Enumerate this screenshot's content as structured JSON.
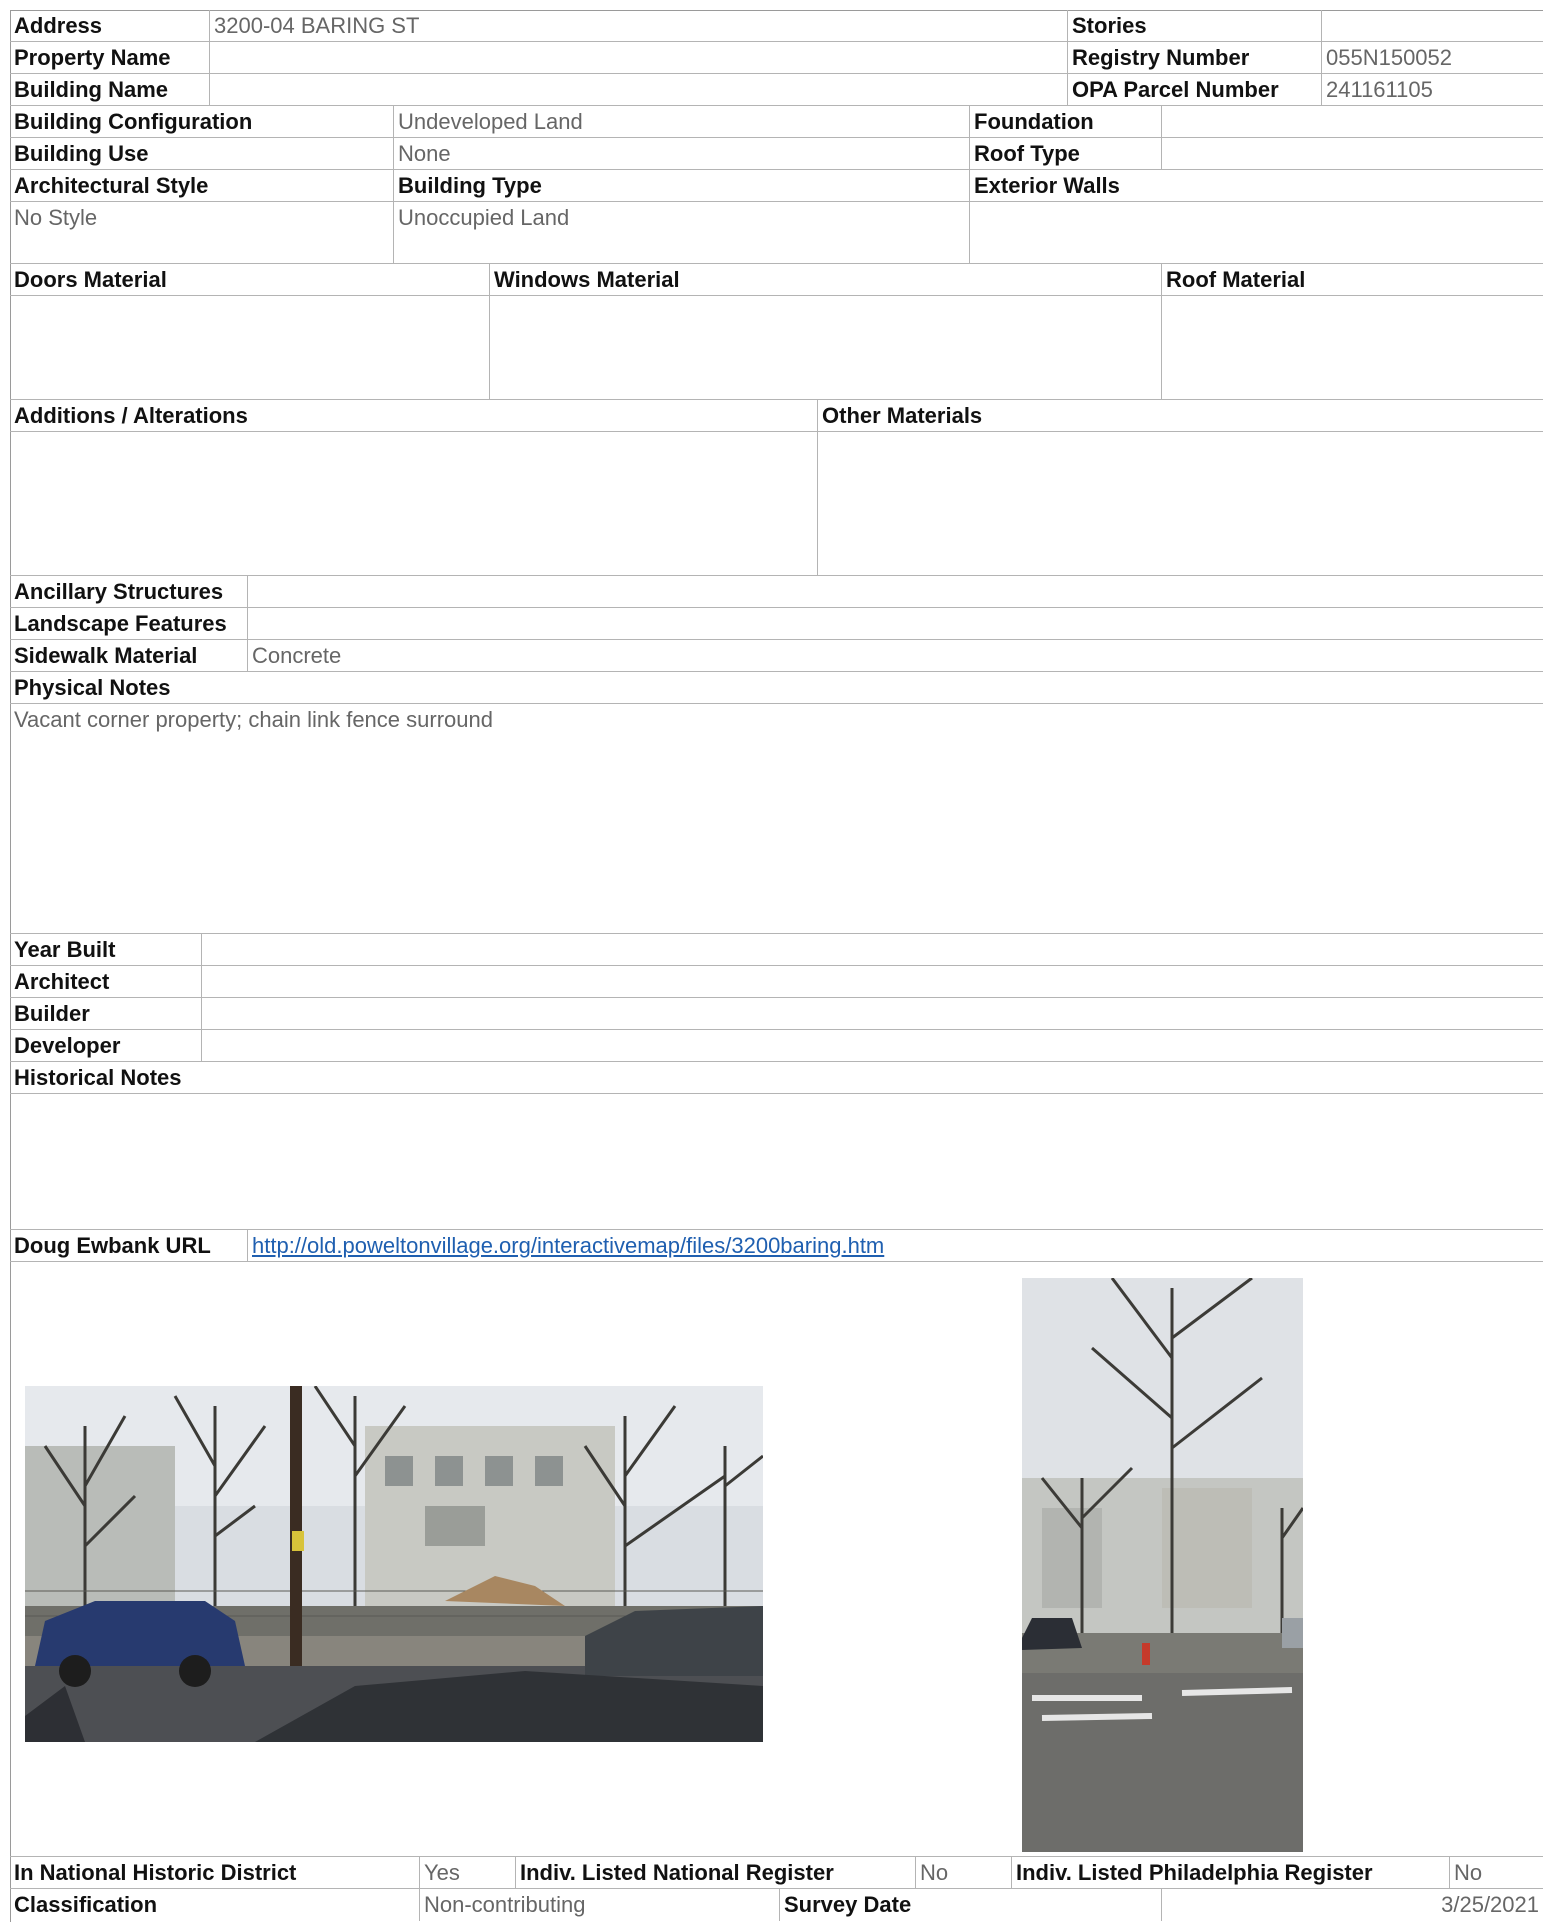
{
  "header": {
    "address_label": "Address",
    "address": "3200-04 BARING ST",
    "property_name_label": "Property Name",
    "property_name": "",
    "building_name_label": "Building Name",
    "building_name": "",
    "stories_label": "Stories",
    "stories": "",
    "registry_number_label": "Registry Number",
    "registry_number": "055N150052",
    "opa_parcel_label": "OPA Parcel Number",
    "opa_parcel": "241161105"
  },
  "building": {
    "configuration_label": "Building Configuration",
    "configuration": "Undeveloped Land",
    "use_label": "Building Use",
    "use": "None",
    "foundation_label": "Foundation",
    "foundation": "",
    "roof_type_label": "Roof Type",
    "roof_type": "",
    "architectural_style_label": "Architectural Style",
    "architectural_style": "No Style",
    "building_type_label": "Building Type",
    "building_type": "Unoccupied Land",
    "exterior_walls_label": "Exterior Walls",
    "exterior_walls": ""
  },
  "materials": {
    "doors_label": "Doors Material",
    "doors": "",
    "windows_label": "Windows Material",
    "windows": "",
    "roof_label": "Roof Material",
    "roof": "",
    "additions_label": "Additions / Alterations",
    "additions": "",
    "other_label": "Other Materials",
    "other": ""
  },
  "site": {
    "ancillary_label": "Ancillary Structures",
    "ancillary": "",
    "landscape_label": "Landscape Features",
    "landscape": "",
    "sidewalk_label": "Sidewalk Material",
    "sidewalk": "Concrete",
    "physical_notes_label": "Physical Notes",
    "physical_notes": "Vacant corner property; chain link fence surround"
  },
  "history": {
    "year_built_label": "Year Built",
    "year_built": "",
    "architect_label": "Architect",
    "architect": "",
    "builder_label": "Builder",
    "builder": "",
    "developer_label": "Developer",
    "developer": "",
    "historical_notes_label": "Historical Notes",
    "historical_notes": "",
    "url_label": "Doug Ewbank URL",
    "url": "http://old.poweltonvillage.org/interactivemap/files/3200baring.htm"
  },
  "footer": {
    "national_district_label": "In National Historic District",
    "national_district": "Yes",
    "national_register_label": "Indiv. Listed National Register",
    "national_register": "No",
    "phila_register_label": "Indiv. Listed Philadelphia Register",
    "phila_register": "No",
    "classification_label": "Classification",
    "classification": "Non-contributing",
    "survey_date_label": "Survey Date",
    "survey_date": "3/25/2021"
  }
}
